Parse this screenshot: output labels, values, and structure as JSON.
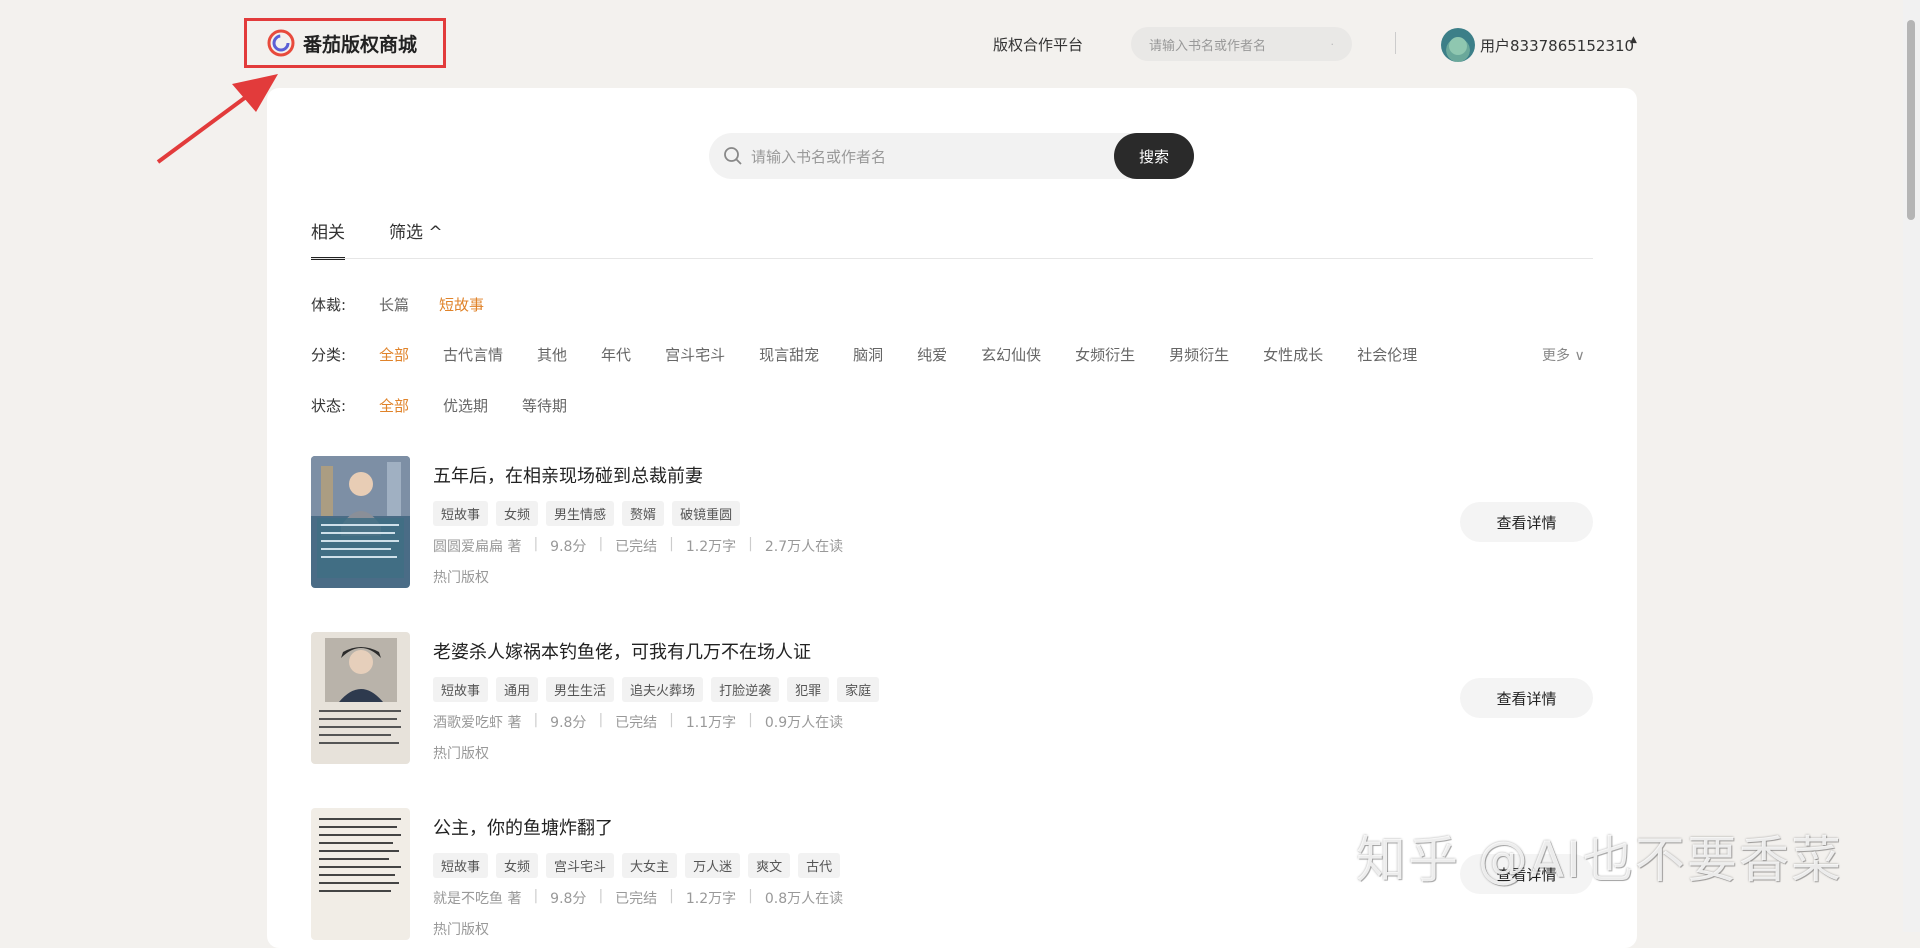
{
  "header": {
    "logo_text": "番茄版权商城",
    "platform_link": "版权合作平台",
    "search_placeholder": "请输入书名或作者名",
    "username": "用户8337865152310"
  },
  "search": {
    "placeholder": "请输入书名或作者名",
    "button": "搜索"
  },
  "tabs": [
    {
      "label": "相关"
    },
    {
      "label": "筛选 ^"
    }
  ],
  "filters": {
    "genre_label": "体裁:",
    "genre_options": [
      "长篇",
      "短故事"
    ],
    "category_label": "分类:",
    "category_options": [
      "全部",
      "古代言情",
      "其他",
      "年代",
      "宫斗宅斗",
      "现言甜宠",
      "脑洞",
      "纯爱",
      "玄幻仙侠",
      "女频衍生",
      "男频衍生",
      "女性成长",
      "社会伦理"
    ],
    "more": "更多 ∨",
    "status_label": "状态:",
    "status_options": [
      "全部",
      "优选期",
      "等待期"
    ]
  },
  "books": [
    {
      "title": "五年后，在相亲现场碰到总裁前妻",
      "tags": [
        "短故事",
        "女频",
        "男生情感",
        "赘婿",
        "破镜重圆"
      ],
      "author": "圆圆爱扁扁 著",
      "score": "9.8分",
      "status": "已完结",
      "words": "1.2万字",
      "readers": "2.7万人在读",
      "hot": "热门版权",
      "button": "查看详情"
    },
    {
      "title": "老婆杀人嫁祸本钓鱼佬，可我有几万不在场人证",
      "tags": [
        "短故事",
        "通用",
        "男生生活",
        "追夫火葬场",
        "打脸逆袭",
        "犯罪",
        "家庭"
      ],
      "author": "酒歌爱吃虾 著",
      "score": "9.8分",
      "status": "已完结",
      "words": "1.1万字",
      "readers": "0.9万人在读",
      "hot": "热门版权",
      "button": "查看详情"
    },
    {
      "title": "公主，你的鱼塘炸翻了",
      "tags": [
        "短故事",
        "女频",
        "宫斗宅斗",
        "大女主",
        "万人迷",
        "爽文",
        "古代"
      ],
      "author": "就是不吃鱼 著",
      "score": "9.8分",
      "status": "已完结",
      "words": "1.2万字",
      "readers": "0.8万人在读",
      "hot": "热门版权",
      "button": "查看详情"
    }
  ],
  "watermark": "知乎 @AI也不要香菜",
  "colors": {
    "accent": "#e0832a",
    "highlight_box": "#e23b3b",
    "button_dark": "#2a2a2a"
  }
}
